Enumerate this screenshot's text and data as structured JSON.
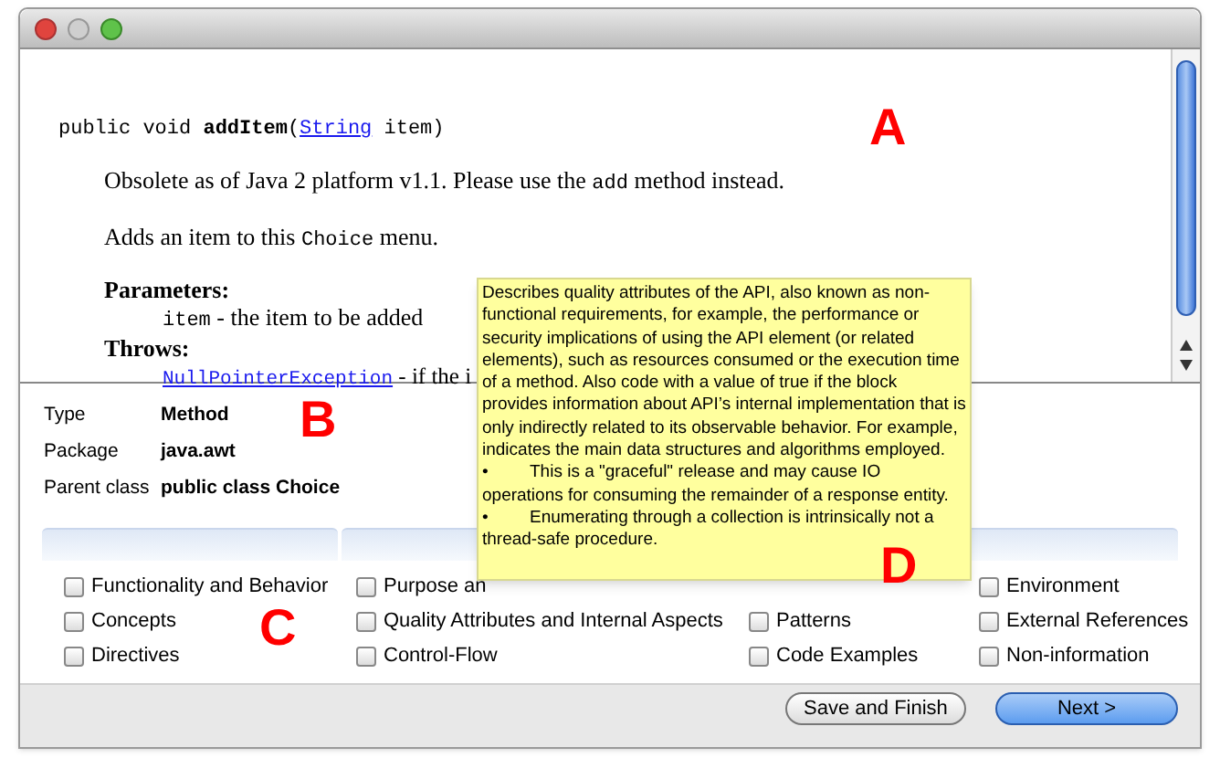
{
  "doc": {
    "signature": [
      {
        "kind": "text",
        "text": "public void "
      },
      {
        "kind": "bold",
        "text": "addItem"
      },
      {
        "kind": "text",
        "text": "("
      },
      {
        "kind": "link",
        "text": "String"
      },
      {
        "kind": "text",
        "text": " item)"
      }
    ],
    "paragraphs": [
      [
        {
          "kind": "text",
          "text": "Obsolete as of Java 2 platform v1.1. Please use the "
        },
        {
          "kind": "code",
          "text": "add"
        },
        {
          "kind": "text",
          "text": " method instead."
        }
      ],
      [
        {
          "kind": "text",
          "text": "Adds an item to this "
        },
        {
          "kind": "code",
          "text": "Choice"
        },
        {
          "kind": "text",
          "text": " menu."
        }
      ]
    ],
    "parameters_heading": "Parameters:",
    "parameter": [
      {
        "kind": "code",
        "text": "item"
      },
      {
        "kind": "text",
        "text": " - the item to be added"
      }
    ],
    "throws_heading": "Throws:",
    "throw": [
      {
        "kind": "link",
        "text": "NullPointerException"
      },
      {
        "kind": "text",
        "text": " - if the i"
      }
    ]
  },
  "info": [
    {
      "label": "Type",
      "value": "Method"
    },
    {
      "label": "Package",
      "value": "java.awt"
    },
    {
      "label": "Parent class",
      "value": "public class Choice"
    }
  ],
  "categories": [
    [
      {
        "label": "Functionality and Behavior",
        "checked": false
      },
      {
        "label": "Concepts",
        "checked": false
      },
      {
        "label": "Directives",
        "checked": false
      }
    ],
    [
      {
        "label": "Purpose an",
        "checked": false
      },
      {
        "label": "Quality Attributes and Internal Aspects",
        "checked": false
      },
      {
        "label": "Control-Flow",
        "checked": false
      }
    ],
    [
      {
        "label": "Patterns",
        "checked": false
      },
      {
        "label": "Code Examples",
        "checked": false
      }
    ],
    [
      {
        "label": "Environment",
        "checked": false
      },
      {
        "label": "External References",
        "checked": false
      },
      {
        "label": "Non-information",
        "checked": false
      }
    ]
  ],
  "tooltip": {
    "text": "Describes quality attributes of the API, also known as non-functional requirements, for example, the performance or security implications of using the API element (or related elements), such as resources consumed or the execution time of a method. Also code with a value of true if the block provides information about API’s internal implementation that is only indirectly related to its observable behavior. For example, indicates the main data structures and algorithms employed.",
    "bullets": [
      {
        "mark": "•",
        "text": "This is a \"graceful\" release and may cause IO operations for consuming the remainder of a response entity."
      },
      {
        "mark": "•",
        "text": "Enumerating through a collection is intrinsically not a thread-safe procedure."
      }
    ]
  },
  "annotations": [
    "A",
    "B",
    "C",
    "D"
  ],
  "buttons": [
    {
      "label": "Save and Finish",
      "primary": false
    },
    {
      "label": "Next >",
      "primary": true
    }
  ]
}
